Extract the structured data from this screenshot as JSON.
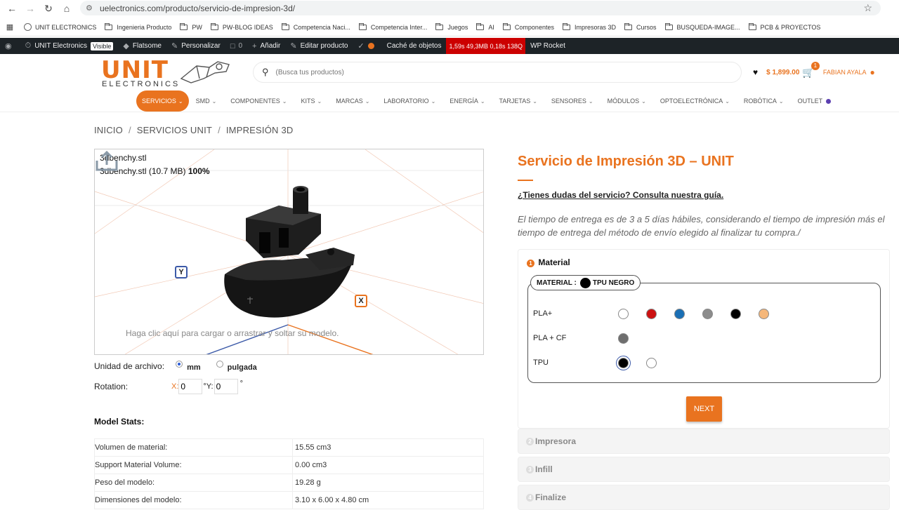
{
  "browser": {
    "url": "uelectronics.com/producto/servicio-de-impresion-3d/"
  },
  "bookmarks": [
    {
      "label": "UNIT ELECTRONICS",
      "icon": "earth-icon"
    },
    {
      "label": "Ingenieria Producto",
      "icon": "folder-icon"
    },
    {
      "label": "PW",
      "icon": "folder-icon"
    },
    {
      "label": "PW-BLOG IDEAS",
      "icon": "folder-icon"
    },
    {
      "label": "Competencia Naci...",
      "icon": "folder-icon"
    },
    {
      "label": "Competencia Inter...",
      "icon": "folder-icon"
    },
    {
      "label": "Juegos",
      "icon": "folder-icon"
    },
    {
      "label": "AI",
      "icon": "folder-icon"
    },
    {
      "label": "Componentes",
      "icon": "folder-icon"
    },
    {
      "label": "Impresoras 3D",
      "icon": "folder-icon"
    },
    {
      "label": "Cursos",
      "icon": "folder-icon"
    },
    {
      "label": "BUSQUEDA-IMAGE...",
      "icon": "folder-icon"
    },
    {
      "label": "PCB & PROYECTOS",
      "icon": "folder-icon"
    }
  ],
  "wpbar": {
    "site": "UNIT Electronics",
    "visible": "Visible",
    "flatsome": "Flatsome",
    "customize": "Personalizar",
    "comments": "0",
    "add": "Añadir",
    "edit": "Editar producto",
    "cache": "Caché de objetos",
    "perf": "1,59s  49,3MB  0,18s  138Q",
    "rocket": "WP Rocket"
  },
  "header": {
    "logo_big": "UNIT",
    "logo_small": "ELECTRONICS",
    "search_placeholder": "(Busca tus productos)",
    "cart_total": "$ 1,899.00",
    "cart_count": "1",
    "user_name": "FABIAN AYALA"
  },
  "nav": [
    {
      "label": "SERVICIOS",
      "chevron": true
    },
    {
      "label": "SMD",
      "chevron": true
    },
    {
      "label": "COMPONENTES",
      "chevron": true
    },
    {
      "label": "KITS",
      "chevron": true
    },
    {
      "label": "MARCAS",
      "chevron": true
    },
    {
      "label": "LABORATORIO",
      "chevron": true
    },
    {
      "label": "ENERGÍA",
      "chevron": true
    },
    {
      "label": "TARJETAS",
      "chevron": true
    },
    {
      "label": "SENSORES",
      "chevron": true
    },
    {
      "label": "MÓDULOS",
      "chevron": true
    },
    {
      "label": "OPTOELECTRÓNICA",
      "chevron": true
    },
    {
      "label": "ROBÓTICA",
      "chevron": true
    },
    {
      "label": "OUTLET",
      "chevron": false
    }
  ],
  "breadcrumb": {
    "home": "INICIO",
    "category": "SERVICIOS UNIT",
    "current": "IMPRESIÓN 3D"
  },
  "viewer": {
    "filename": "3dbenchy.stl",
    "file_info": "3dbenchy.stl (10.7 MB)",
    "progress": "100%",
    "axis_y": "Y",
    "axis_x": "X",
    "upload_hint": "Haga clic aquí para cargar o arrastrar y soltar su modelo."
  },
  "units": {
    "label": "Unidad de archivo:",
    "mm": "mm",
    "inch": "pulgada",
    "selected": "mm"
  },
  "rotation": {
    "label": "Rotation:",
    "x_label": "X:",
    "x_value": "0",
    "y_label": "°Y:",
    "y_value": "0",
    "deg": "°"
  },
  "stats": {
    "title": "Model Stats:",
    "rows": [
      {
        "label": "Volumen de material:",
        "value": "15.55 cm3"
      },
      {
        "label": "Support Material Volume:",
        "value": "0.00 cm3"
      },
      {
        "label": "Peso del modelo:",
        "value": "19.28 g"
      },
      {
        "label": "Dimensiones del modelo:",
        "value": "3.10 x 6.00 x 4.80 cm"
      }
    ]
  },
  "product": {
    "title": "Servicio de Impresión 3D – UNIT",
    "guide_link": "¿Tienes dudas del servicio? Consulta nuestra guía.",
    "delivery": "El tiempo de entrega es de 3 a 5 días hábiles, considerando el tiempo de impresión más el tiempo de entrega del método de envío elegido al finalizar tu compra./"
  },
  "steps": {
    "material": {
      "num": "1",
      "title": "Material"
    },
    "printer": {
      "num": "2",
      "title": "Impresora"
    },
    "infill": {
      "num": "3",
      "title": "Infill"
    },
    "finalize": {
      "num": "4",
      "title": "Finalize"
    },
    "next_button": "NEXT"
  },
  "material": {
    "legend_label": "MATERIAL :",
    "selected": "TPU NEGRO",
    "selected_color": "#000000",
    "rows": [
      {
        "name": "PLA+",
        "colors": [
          "#ffffff",
          "#cc1111",
          "#1a6fb5",
          "#8c8c8c",
          "#000000",
          "#f5b77a"
        ]
      },
      {
        "name": "PLA + CF",
        "colors": [
          "#6e6e6e"
        ]
      },
      {
        "name": "TPU",
        "colors": [
          "#000000",
          "#ffffff"
        ]
      }
    ]
  },
  "colors": {
    "accent": "#e9731f",
    "admin_bar": "#1d2327"
  }
}
